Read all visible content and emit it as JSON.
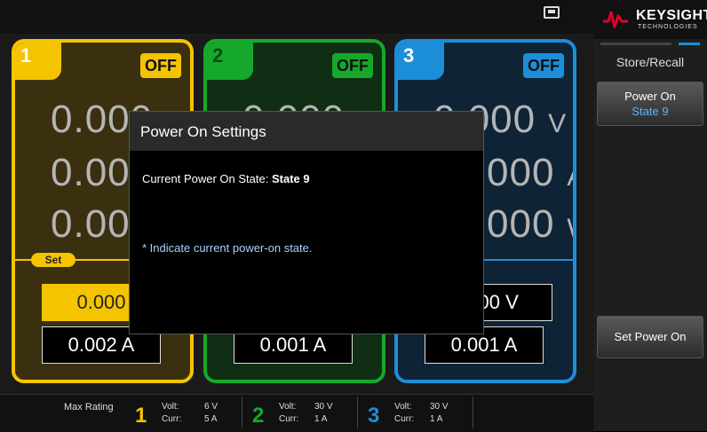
{
  "brand": {
    "name": "KEYSIGHT",
    "sub": "TECHNOLOGIES"
  },
  "softkeys": {
    "title": "Store/Recall",
    "power_on": {
      "label": "Power On",
      "value": "State 9"
    },
    "set_power_on": {
      "label": "Set Power On"
    }
  },
  "channels": [
    {
      "num": "1",
      "state": "OFF",
      "voltage": "0.000",
      "current": "0.000",
      "power": "0.000",
      "set_label": "Set",
      "set_voltage": "0.000",
      "set_current": "0.002 A"
    },
    {
      "num": "2",
      "state": "OFF",
      "voltage": "0.000",
      "set_current": "0.001 A"
    },
    {
      "num": "3",
      "state": "OFF",
      "voltage": "0.000",
      "current": "000",
      "power": "000",
      "set_voltage": "000 V",
      "set_current": "0.001 A"
    }
  ],
  "units": {
    "v": "V",
    "a": "A",
    "w": "W"
  },
  "dialog": {
    "title": "Power On Settings",
    "current_label": "Current Power On State:",
    "current_value": "State 9",
    "note": "* Indicate current power-on state."
  },
  "max_rating": {
    "label": "Max Rating",
    "volt_label": "Volt:",
    "curr_label": "Curr:",
    "items": [
      {
        "num": "1",
        "volt": "6  V",
        "curr": "5  A",
        "color": "#f5c400"
      },
      {
        "num": "2",
        "volt": "30  V",
        "curr": "1  A",
        "color": "#16a82a"
      },
      {
        "num": "3",
        "volt": "30  V",
        "curr": "1  A",
        "color": "#1d8ed8"
      }
    ]
  }
}
